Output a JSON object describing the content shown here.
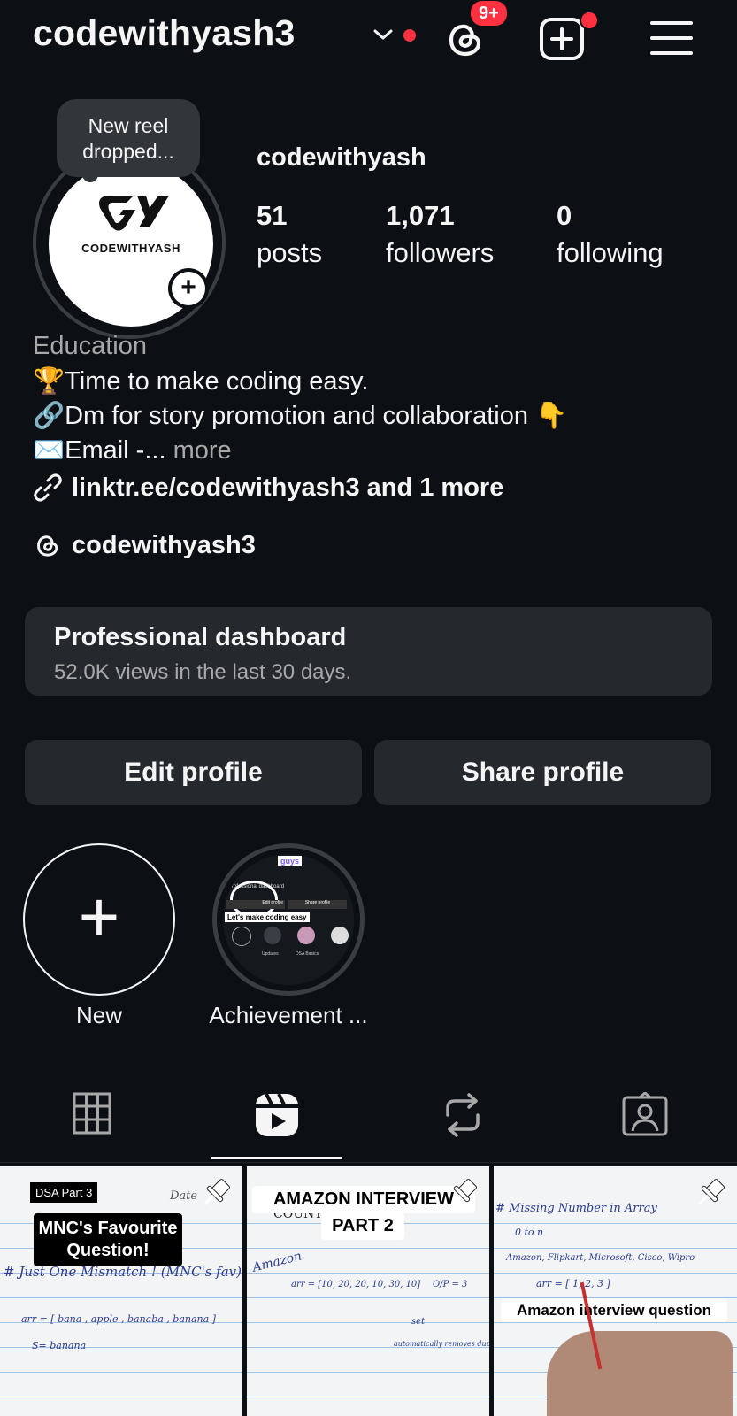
{
  "header": {
    "username": "codewithyash3",
    "notification_badge": "9+"
  },
  "profile": {
    "avatar_text": "CODEWITHYASH",
    "note_bubble": "New reel dropped...",
    "name": "codewithyash",
    "stats": [
      {
        "value": "51",
        "label": "posts"
      },
      {
        "value": "1,071",
        "label": "followers"
      },
      {
        "value": "0",
        "label": "following"
      }
    ],
    "category": "Education",
    "bio_lines": [
      "🏆Time to make coding easy.",
      "🔗Dm for story promotion and collaboration 👇",
      "✉️Email -..."
    ],
    "bio_more": " more",
    "link": "linktr.ee/codewithyash3 and 1 more",
    "threads_handle": "codewithyash3"
  },
  "dashboard": {
    "title": "Professional dashboard",
    "subtitle": "52.0K views in the last 30 days."
  },
  "actions": {
    "edit": "Edit profile",
    "share": "Share profile"
  },
  "highlights": [
    {
      "label": "New"
    },
    {
      "label": "Achievement ..."
    }
  ],
  "highlight_preview": {
    "top_tag": "guys",
    "line1": "Let's make coding easy",
    "dash_label": "Professional dashboard",
    "btn1": "Edit profile",
    "btn2": "Share profile",
    "tags": [
      "Updates",
      "DSA Basics"
    ]
  },
  "grid": [
    {
      "tag": "DSA Part 3",
      "date": "Date",
      "caption": "MNC's Favourite Question!",
      "heading": "# Just One Mismatch ! (MNC's fav)",
      "line1": "arr = [ bana , apple , banaba , banana ]",
      "line2": "S= banana"
    },
    {
      "caption1": "AMAZON INTERVIEW",
      "caption2": "PART 2",
      "heading": "COUNT D    IENT",
      "brand": "Amazon",
      "line1": "arr = [10, 20, 20, 10, 30, 10]",
      "line2": "O/P = 3",
      "line3": "set",
      "line4": "automatically removes duplicates"
    },
    {
      "heading": "# Missing Number in Array",
      "line1": "0 to n",
      "line2": "Amazon, Flipkart, Microsoft, Cisco, Wipro",
      "line3": "arr = [ 1, 2, 3 ]",
      "caption": "Amazon interview question"
    }
  ],
  "colors": {
    "background": "#0c1014",
    "surface": "#25292e",
    "accent_red": "#ff3040",
    "muted_text": "#a8a8a8"
  }
}
